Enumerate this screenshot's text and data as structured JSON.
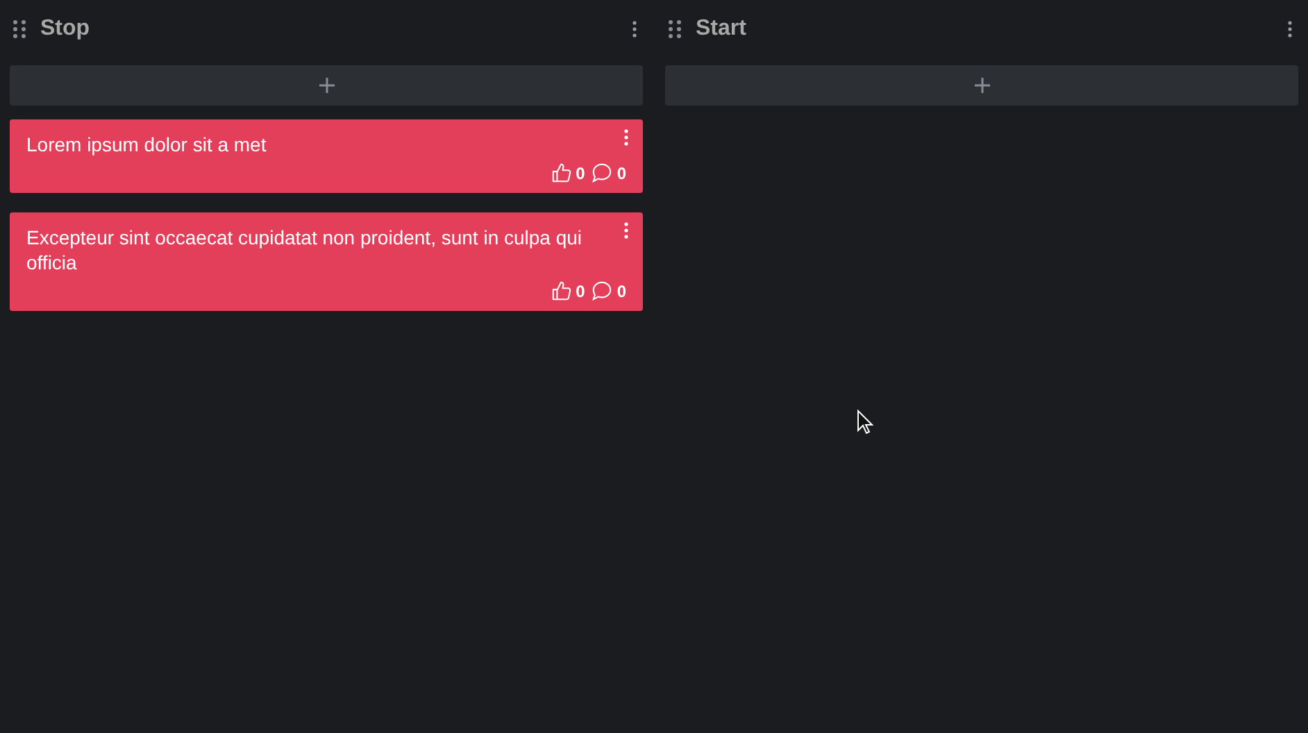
{
  "columns": [
    {
      "title": "Stop",
      "cards": [
        {
          "text": "Lorem ipsum dolor sit a met",
          "likes": "0",
          "comments": "0"
        },
        {
          "text": "Excepteur sint occaecat cupidatat non proident, sunt in culpa qui officia",
          "likes": "0",
          "comments": "0"
        }
      ]
    },
    {
      "title": "Start"
    }
  ]
}
